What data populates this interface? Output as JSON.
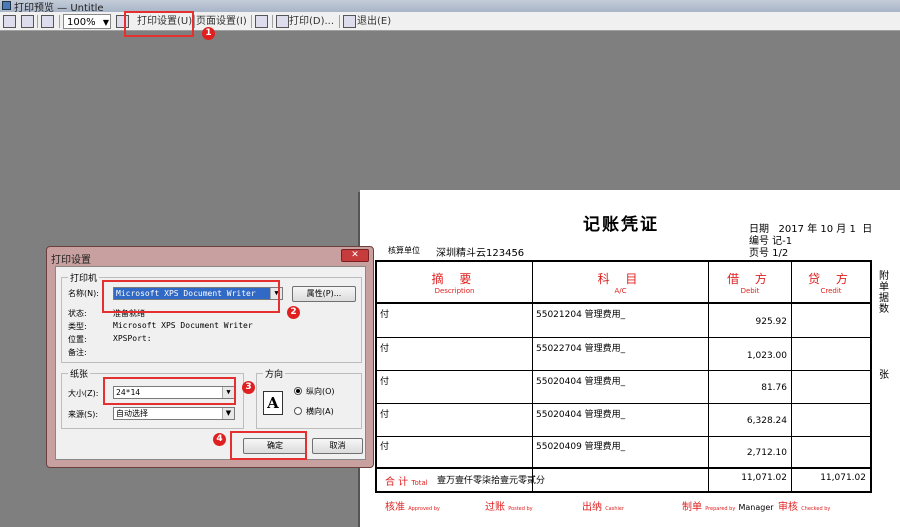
{
  "window": {
    "title": "打印预览 — Untitle"
  },
  "toolbar": {
    "zoom": "100%",
    "print_setup": "打印设置(U)",
    "page_setup": "页面设置(I)",
    "print": "打印(D)...",
    "exit": "退出(E)"
  },
  "badges": [
    "1",
    "2",
    "3",
    "4"
  ],
  "voucher": {
    "title": "记账凭证",
    "date_label": "日期",
    "date_year": "2017",
    "date_year_unit": "年",
    "date_month": "10",
    "date_month_unit": "月",
    "date_day": "1",
    "date_day_unit": "日",
    "number_line": "编号 记-1",
    "page_line": "页号 1/2",
    "unit_label": "核算单位",
    "unit_name": "深圳精斗云123456",
    "headers": {
      "summary_cn": "摘 要",
      "summary_en": "Description",
      "account_cn": "科 目",
      "account_en": "A/C",
      "debit_cn": "借 方",
      "debit_en": "Debit",
      "credit_cn": "贷 方",
      "credit_en": "Credit"
    },
    "rows": [
      {
        "summary": "付",
        "account": "55021204 管理费用_",
        "debit": "925.92",
        "credit": ""
      },
      {
        "summary": "付",
        "account": "55022704 管理费用_",
        "debit": "1,023.00",
        "credit": ""
      },
      {
        "summary": "付",
        "account": "55020404 管理费用_",
        "debit": "81.76",
        "credit": ""
      },
      {
        "summary": "付",
        "account": "55020404 管理费用_",
        "debit": "6,328.24",
        "credit": ""
      },
      {
        "summary": "付",
        "account": "55020409 管理费用_",
        "debit": "2,712.10",
        "credit": ""
      }
    ],
    "total": {
      "label": "合 计",
      "label_en": "Total",
      "words": "壹万壹仟零柒拾壹元零贰分",
      "debit": "11,071.02",
      "credit": "11,071.02"
    },
    "side_chars": [
      "附",
      "单",
      "据",
      "数",
      "张"
    ],
    "signatures": [
      {
        "label": "核准",
        "en": "Approved by"
      },
      {
        "label": "过账",
        "en": "Posted by"
      },
      {
        "label": "出纳",
        "en": "Cashier"
      },
      {
        "label": "制单",
        "en": "Prepared by",
        "value": "Manager"
      },
      {
        "label": "审核",
        "en": "Checked by"
      }
    ]
  },
  "dialog": {
    "title": "打印设置",
    "close": "✕",
    "printer_group": "打印机",
    "name_label": "名称(N):",
    "printer_name": "Microsoft XPS Document Writer",
    "properties": "属性(P)...",
    "status_label": "状态:",
    "status_value": "准备就绪",
    "type_label": "类型:",
    "type_value": "Microsoft XPS Document Writer",
    "where_label": "位置:",
    "where_value": "XPSPort:",
    "comment_label": "备注:",
    "paper_group": "纸张",
    "size_label": "大小(Z):",
    "size_value": "24*14",
    "source_label": "来源(S):",
    "source_value": "自动选择",
    "orientation_group": "方向",
    "portrait": "纵向(O)",
    "landscape": "横向(A)",
    "orientation_selected": "portrait",
    "ok": "确定",
    "cancel": "取消"
  }
}
